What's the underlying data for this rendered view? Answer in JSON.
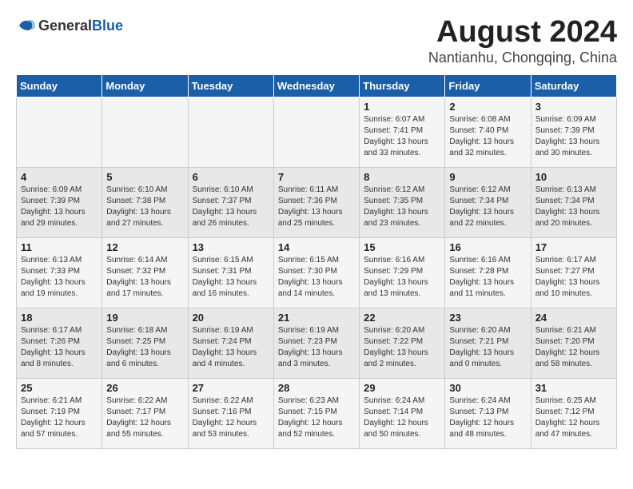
{
  "logo": {
    "general": "General",
    "blue": "Blue"
  },
  "title": "August 2024",
  "subtitle": "Nantianhu, Chongqing, China",
  "headers": [
    "Sunday",
    "Monday",
    "Tuesday",
    "Wednesday",
    "Thursday",
    "Friday",
    "Saturday"
  ],
  "weeks": [
    [
      {
        "day": "",
        "content": ""
      },
      {
        "day": "",
        "content": ""
      },
      {
        "day": "",
        "content": ""
      },
      {
        "day": "",
        "content": ""
      },
      {
        "day": "1",
        "content": "Sunrise: 6:07 AM\nSunset: 7:41 PM\nDaylight: 13 hours\nand 33 minutes."
      },
      {
        "day": "2",
        "content": "Sunrise: 6:08 AM\nSunset: 7:40 PM\nDaylight: 13 hours\nand 32 minutes."
      },
      {
        "day": "3",
        "content": "Sunrise: 6:09 AM\nSunset: 7:39 PM\nDaylight: 13 hours\nand 30 minutes."
      }
    ],
    [
      {
        "day": "4",
        "content": "Sunrise: 6:09 AM\nSunset: 7:39 PM\nDaylight: 13 hours\nand 29 minutes."
      },
      {
        "day": "5",
        "content": "Sunrise: 6:10 AM\nSunset: 7:38 PM\nDaylight: 13 hours\nand 27 minutes."
      },
      {
        "day": "6",
        "content": "Sunrise: 6:10 AM\nSunset: 7:37 PM\nDaylight: 13 hours\nand 26 minutes."
      },
      {
        "day": "7",
        "content": "Sunrise: 6:11 AM\nSunset: 7:36 PM\nDaylight: 13 hours\nand 25 minutes."
      },
      {
        "day": "8",
        "content": "Sunrise: 6:12 AM\nSunset: 7:35 PM\nDaylight: 13 hours\nand 23 minutes."
      },
      {
        "day": "9",
        "content": "Sunrise: 6:12 AM\nSunset: 7:34 PM\nDaylight: 13 hours\nand 22 minutes."
      },
      {
        "day": "10",
        "content": "Sunrise: 6:13 AM\nSunset: 7:34 PM\nDaylight: 13 hours\nand 20 minutes."
      }
    ],
    [
      {
        "day": "11",
        "content": "Sunrise: 6:13 AM\nSunset: 7:33 PM\nDaylight: 13 hours\nand 19 minutes."
      },
      {
        "day": "12",
        "content": "Sunrise: 6:14 AM\nSunset: 7:32 PM\nDaylight: 13 hours\nand 17 minutes."
      },
      {
        "day": "13",
        "content": "Sunrise: 6:15 AM\nSunset: 7:31 PM\nDaylight: 13 hours\nand 16 minutes."
      },
      {
        "day": "14",
        "content": "Sunrise: 6:15 AM\nSunset: 7:30 PM\nDaylight: 13 hours\nand 14 minutes."
      },
      {
        "day": "15",
        "content": "Sunrise: 6:16 AM\nSunset: 7:29 PM\nDaylight: 13 hours\nand 13 minutes."
      },
      {
        "day": "16",
        "content": "Sunrise: 6:16 AM\nSunset: 7:28 PM\nDaylight: 13 hours\nand 11 minutes."
      },
      {
        "day": "17",
        "content": "Sunrise: 6:17 AM\nSunset: 7:27 PM\nDaylight: 13 hours\nand 10 minutes."
      }
    ],
    [
      {
        "day": "18",
        "content": "Sunrise: 6:17 AM\nSunset: 7:26 PM\nDaylight: 13 hours\nand 8 minutes."
      },
      {
        "day": "19",
        "content": "Sunrise: 6:18 AM\nSunset: 7:25 PM\nDaylight: 13 hours\nand 6 minutes."
      },
      {
        "day": "20",
        "content": "Sunrise: 6:19 AM\nSunset: 7:24 PM\nDaylight: 13 hours\nand 4 minutes."
      },
      {
        "day": "21",
        "content": "Sunrise: 6:19 AM\nSunset: 7:23 PM\nDaylight: 13 hours\nand 3 minutes."
      },
      {
        "day": "22",
        "content": "Sunrise: 6:20 AM\nSunset: 7:22 PM\nDaylight: 13 hours\nand 2 minutes."
      },
      {
        "day": "23",
        "content": "Sunrise: 6:20 AM\nSunset: 7:21 PM\nDaylight: 13 hours\nand 0 minutes."
      },
      {
        "day": "24",
        "content": "Sunrise: 6:21 AM\nSunset: 7:20 PM\nDaylight: 12 hours\nand 58 minutes."
      }
    ],
    [
      {
        "day": "25",
        "content": "Sunrise: 6:21 AM\nSunset: 7:19 PM\nDaylight: 12 hours\nand 57 minutes."
      },
      {
        "day": "26",
        "content": "Sunrise: 6:22 AM\nSunset: 7:17 PM\nDaylight: 12 hours\nand 55 minutes."
      },
      {
        "day": "27",
        "content": "Sunrise: 6:22 AM\nSunset: 7:16 PM\nDaylight: 12 hours\nand 53 minutes."
      },
      {
        "day": "28",
        "content": "Sunrise: 6:23 AM\nSunset: 7:15 PM\nDaylight: 12 hours\nand 52 minutes."
      },
      {
        "day": "29",
        "content": "Sunrise: 6:24 AM\nSunset: 7:14 PM\nDaylight: 12 hours\nand 50 minutes."
      },
      {
        "day": "30",
        "content": "Sunrise: 6:24 AM\nSunset: 7:13 PM\nDaylight: 12 hours\nand 48 minutes."
      },
      {
        "day": "31",
        "content": "Sunrise: 6:25 AM\nSunset: 7:12 PM\nDaylight: 12 hours\nand 47 minutes."
      }
    ]
  ]
}
